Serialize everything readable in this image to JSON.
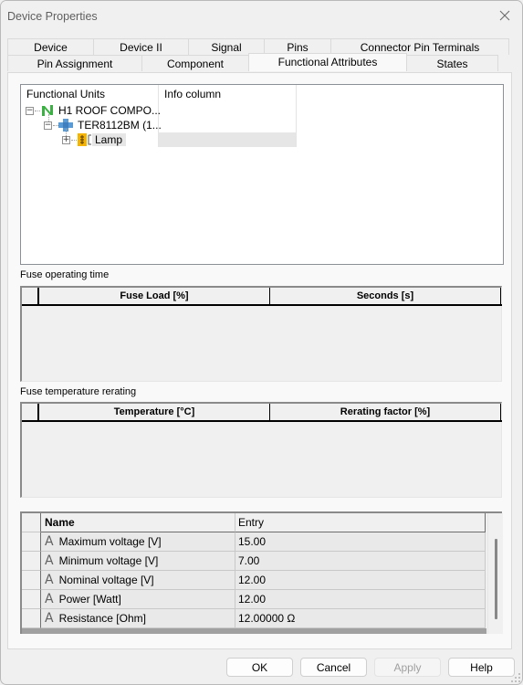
{
  "window": {
    "title": "Device Properties"
  },
  "tabs": {
    "row1": [
      {
        "label": "Device"
      },
      {
        "label": "Device II"
      },
      {
        "label": "Signal"
      },
      {
        "label": "Pins"
      },
      {
        "label": "Connector Pin Terminals"
      }
    ],
    "row2": [
      {
        "label": "Pin Assignment"
      },
      {
        "label": "Component"
      },
      {
        "label": "Functional Attributes",
        "active": true
      },
      {
        "label": "States"
      }
    ]
  },
  "tree": {
    "columns": [
      "Functional Units",
      "Info column"
    ],
    "nodes": [
      {
        "label": "H1 ROOF COMPO...",
        "icon": "device-n-icon",
        "expander": "−",
        "level": 0
      },
      {
        "label": "TER8112BM (1...",
        "icon": "component-block-icon",
        "expander": "−",
        "level": 1
      },
      {
        "label": "Lamp",
        "icon": "function-lamp-icon",
        "expander": "+",
        "level": 2,
        "selected": true
      }
    ]
  },
  "fuse_operating_time": {
    "label": "Fuse operating time",
    "columns": [
      "Fuse Load [%]",
      "Seconds [s]"
    ],
    "rows": []
  },
  "fuse_temperature_rerating": {
    "label": "Fuse temperature rerating",
    "columns": [
      "Temperature [°C]",
      "Rerating factor [%]"
    ],
    "rows": []
  },
  "attributes": {
    "columns": [
      "Name",
      "Entry"
    ],
    "rows": [
      {
        "name": "Maximum voltage [V]",
        "entry": "15.00"
      },
      {
        "name": "Minimum voltage [V]",
        "entry": "7.00"
      },
      {
        "name": "Nominal voltage [V]",
        "entry": "12.00"
      },
      {
        "name": "Power [Watt]",
        "entry": "12.00"
      },
      {
        "name": "Resistance [Ohm]",
        "entry": "12.00000 Ω"
      }
    ],
    "row_icon_glyph": "A"
  },
  "buttons": {
    "ok": "OK",
    "cancel": "Cancel",
    "apply": "Apply",
    "help": "Help"
  },
  "colors": {
    "device_icon": "#3cb043",
    "component_icon": "#5b9bd5",
    "function_icon": "#f5b400"
  }
}
